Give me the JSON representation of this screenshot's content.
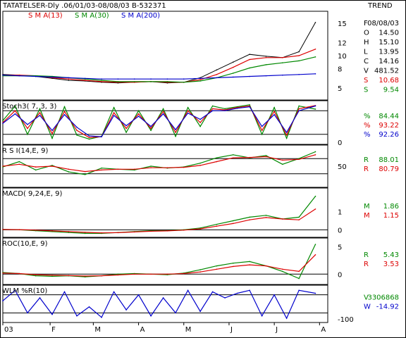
{
  "header": {
    "symbol_line": "TATATELSER-Dly .06/01/03-08/08/03  B-532371",
    "view_label": "TREND"
  },
  "colors": {
    "price": "#000000",
    "sma13": "#dd0000",
    "sma30": "#008800",
    "sma200": "#0000cc",
    "frame": "#000000",
    "fast": "#008800",
    "slow": "#dd0000",
    "third": "#0000cc"
  },
  "chart_data": [
    {
      "type": "line",
      "id": "price",
      "title": "",
      "legend": [
        {
          "name": "S M A(13)",
          "color": "#dd0000"
        },
        {
          "name": "S M A(30)",
          "color": "#008800"
        },
        {
          "name": "S M A(200)",
          "color": "#0000cc"
        }
      ],
      "ylim": [
        3.5,
        16.5
      ],
      "yticks": [
        5,
        8,
        10,
        12,
        15
      ],
      "info": [
        {
          "label": "F",
          "value": "08/08/03",
          "color": "#000000"
        },
        {
          "label": "O",
          "value": "14.50",
          "color": "#000000"
        },
        {
          "label": "H",
          "value": "15.10",
          "color": "#000000"
        },
        {
          "label": "L",
          "value": "13.95",
          "color": "#000000"
        },
        {
          "label": "C",
          "value": "14.16",
          "color": "#000000"
        },
        {
          "label": "V",
          "value": "481.52",
          "color": "#000000"
        },
        {
          "label": "S",
          "value": "10.68",
          "color": "#dd0000"
        },
        {
          "label": "S",
          "value": "9.54",
          "color": "#008800"
        }
      ],
      "x": [
        0,
        8,
        16,
        24,
        32,
        40,
        48,
        56,
        64,
        72,
        80,
        88,
        96,
        104,
        112,
        120,
        128,
        136,
        144,
        152
      ],
      "series": [
        {
          "name": "Price",
          "values": [
            7.1,
            7.0,
            6.8,
            6.5,
            6.2,
            6.1,
            5.9,
            5.8,
            5.9,
            6.0,
            5.8,
            5.9,
            6.6,
            7.8,
            9.0,
            10.2,
            9.9,
            9.7,
            10.6,
            15.1
          ]
        },
        {
          "name": "S M A(13)",
          "values": [
            7.0,
            7.0,
            6.9,
            6.6,
            6.4,
            6.2,
            6.0,
            5.9,
            5.9,
            6.0,
            5.9,
            5.9,
            6.3,
            7.1,
            8.2,
            9.4,
            9.7,
            9.7,
            10.0,
            11.0
          ]
        },
        {
          "name": "S M A(30)",
          "values": [
            6.9,
            6.9,
            6.9,
            6.8,
            6.6,
            6.4,
            6.2,
            6.0,
            6.0,
            6.0,
            6.0,
            5.9,
            6.1,
            6.6,
            7.3,
            8.1,
            8.6,
            8.9,
            9.2,
            9.8
          ]
        },
        {
          "name": "S M A(200)",
          "values": [
            7.0,
            6.9,
            6.8,
            6.7,
            6.6,
            6.5,
            6.4,
            6.4,
            6.4,
            6.4,
            6.4,
            6.4,
            6.5,
            6.6,
            6.7,
            6.8,
            6.9,
            7.0,
            7.1,
            7.2
          ]
        }
      ]
    },
    {
      "type": "line",
      "id": "stoch",
      "title": "Stoch3( 7, 3, 3)",
      "ylim": [
        0,
        100
      ],
      "guides": [
        20,
        80
      ],
      "yticks": [
        0
      ],
      "info": [
        {
          "label": "%",
          "value": "84.44",
          "color": "#008800"
        },
        {
          "label": "%",
          "value": "93.22",
          "color": "#dd0000"
        },
        {
          "label": "%",
          "value": "92.26",
          "color": "#0000cc"
        }
      ],
      "x": [
        0,
        6,
        12,
        18,
        24,
        30,
        36,
        42,
        48,
        54,
        60,
        66,
        72,
        78,
        84,
        90,
        96,
        102,
        108,
        114,
        120,
        126,
        132,
        138,
        144,
        152
      ],
      "series": [
        {
          "name": "K",
          "values": [
            55,
            92,
            20,
            85,
            10,
            90,
            18,
            8,
            15,
            88,
            25,
            80,
            30,
            85,
            15,
            88,
            40,
            92,
            85,
            90,
            95,
            20,
            88,
            10,
            92,
            84
          ]
        },
        {
          "name": "D",
          "values": [
            50,
            80,
            35,
            75,
            22,
            78,
            30,
            12,
            14,
            75,
            35,
            72,
            35,
            78,
            25,
            80,
            50,
            85,
            82,
            88,
            92,
            30,
            78,
            18,
            85,
            93
          ]
        },
        {
          "name": "Slow",
          "values": [
            48,
            72,
            45,
            68,
            30,
            70,
            38,
            16,
            14,
            68,
            42,
            66,
            40,
            72,
            32,
            74,
            58,
            80,
            80,
            86,
            90,
            40,
            70,
            25,
            80,
            92
          ]
        }
      ]
    },
    {
      "type": "line",
      "id": "rsi",
      "title": "R S I(14,E, 9)",
      "ylim": [
        0,
        100
      ],
      "guides": [
        30,
        70
      ],
      "yticks": [
        50
      ],
      "info": [
        {
          "label": "R",
          "value": "88.01",
          "color": "#008800"
        },
        {
          "label": "R",
          "value": "80.79",
          "color": "#dd0000"
        }
      ],
      "x": [
        0,
        8,
        16,
        24,
        32,
        40,
        48,
        56,
        64,
        72,
        80,
        88,
        96,
        104,
        112,
        120,
        128,
        136,
        144,
        152
      ],
      "series": [
        {
          "name": "RSI",
          "values": [
            48,
            62,
            40,
            52,
            35,
            28,
            45,
            42,
            40,
            50,
            45,
            48,
            58,
            72,
            80,
            72,
            78,
            55,
            70,
            88
          ]
        },
        {
          "name": "Signal",
          "values": [
            50,
            55,
            48,
            50,
            42,
            36,
            40,
            42,
            42,
            46,
            46,
            47,
            52,
            62,
            72,
            73,
            75,
            66,
            68,
            80
          ]
        }
      ]
    },
    {
      "type": "line",
      "id": "macd",
      "title": "MACD( 9,24,E, 9)",
      "ylim": [
        -0.3,
        2.2
      ],
      "guides": [
        0
      ],
      "yticks": [
        1,
        0
      ],
      "info": [
        {
          "label": "M",
          "value": "1.86",
          "color": "#008800"
        },
        {
          "label": "M",
          "value": "1.15",
          "color": "#dd0000"
        }
      ],
      "x": [
        0,
        8,
        16,
        24,
        32,
        40,
        48,
        56,
        64,
        72,
        80,
        88,
        96,
        104,
        112,
        120,
        128,
        136,
        144,
        152
      ],
      "series": [
        {
          "name": "MACD",
          "values": [
            0.02,
            0.0,
            -0.05,
            -0.1,
            -0.15,
            -0.2,
            -0.2,
            -0.15,
            -0.1,
            -0.05,
            -0.05,
            0.0,
            0.1,
            0.3,
            0.5,
            0.7,
            0.8,
            0.6,
            0.7,
            1.86
          ]
        },
        {
          "name": "Signal",
          "values": [
            0.02,
            0.01,
            -0.02,
            -0.06,
            -0.1,
            -0.14,
            -0.17,
            -0.16,
            -0.12,
            -0.08,
            -0.06,
            -0.02,
            0.05,
            0.2,
            0.35,
            0.55,
            0.68,
            0.6,
            0.55,
            1.15
          ]
        }
      ]
    },
    {
      "type": "line",
      "id": "roc",
      "title": "ROC(10,E, 9)",
      "ylim": [
        -1.5,
        6.2
      ],
      "guides": [
        0
      ],
      "yticks": [
        5,
        0
      ],
      "info": [
        {
          "label": "R",
          "value": "5.43",
          "color": "#008800"
        },
        {
          "label": "R",
          "value": "3.53",
          "color": "#dd0000"
        }
      ],
      "x": [
        0,
        8,
        16,
        24,
        32,
        40,
        48,
        56,
        64,
        72,
        80,
        88,
        96,
        104,
        112,
        120,
        128,
        136,
        144,
        152
      ],
      "series": [
        {
          "name": "ROC",
          "values": [
            0.3,
            0.1,
            -0.3,
            -0.4,
            -0.3,
            -0.5,
            -0.3,
            0.0,
            0.1,
            0.0,
            -0.1,
            0.2,
            0.8,
            1.5,
            2.0,
            2.3,
            1.5,
            0.5,
            -0.8,
            5.43
          ]
        },
        {
          "name": "Signal",
          "values": [
            0.2,
            0.1,
            -0.1,
            -0.2,
            -0.25,
            -0.35,
            -0.3,
            -0.15,
            0.0,
            0.0,
            0.0,
            0.1,
            0.4,
            0.9,
            1.4,
            1.7,
            1.5,
            0.9,
            0.5,
            3.53
          ]
        }
      ]
    },
    {
      "type": "line",
      "id": "wlm",
      "title": "WLM %R(10)",
      "ylim": [
        -105,
        5
      ],
      "guides": [
        -20,
        -80
      ],
      "yticks": [
        -100
      ],
      "info": [
        {
          "label": "V",
          "value": "3306868",
          "color": "#008800"
        },
        {
          "label": "W",
          "value": "-14.92",
          "color": "#0000cc"
        }
      ],
      "x": [
        0,
        6,
        12,
        18,
        24,
        30,
        36,
        42,
        48,
        54,
        60,
        66,
        72,
        78,
        84,
        90,
        96,
        102,
        108,
        114,
        120,
        126,
        132,
        138,
        144,
        152
      ],
      "series": [
        {
          "name": "%R",
          "values": [
            -40,
            -5,
            -80,
            -30,
            -85,
            -10,
            -90,
            -60,
            -95,
            -10,
            -70,
            -20,
            -90,
            -30,
            -80,
            -5,
            -75,
            -10,
            -30,
            -15,
            -5,
            -90,
            -20,
            -98,
            -5,
            -15
          ]
        }
      ]
    }
  ],
  "x_axis": {
    "ticks": [
      {
        "x": 0,
        "label": "03"
      },
      {
        "x": 23,
        "label": "F"
      },
      {
        "x": 44,
        "label": "M"
      },
      {
        "x": 66,
        "label": "A"
      },
      {
        "x": 88,
        "label": "M"
      },
      {
        "x": 110,
        "label": "J"
      },
      {
        "x": 132,
        "label": "J"
      },
      {
        "x": 154,
        "label": "A"
      }
    ],
    "xmax": 158
  }
}
